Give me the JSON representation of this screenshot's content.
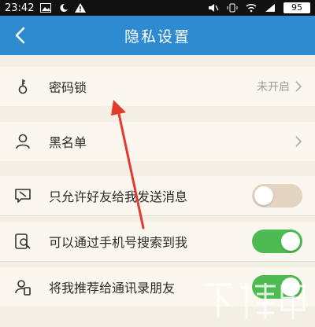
{
  "status_bar": {
    "time": "23:42",
    "battery": "95"
  },
  "nav": {
    "title": "隐私设置"
  },
  "rows": {
    "password_lock": {
      "label": "密码锁",
      "value": "未开启"
    },
    "blacklist": {
      "label": "黑名单"
    },
    "friends_only": {
      "label": "只允许好友给我发送消息",
      "state": "off"
    },
    "search_by_phone": {
      "label": "可以通过手机号搜索到我",
      "state": "on"
    },
    "recommend_contacts": {
      "label": "将我推荐给通讯录朋友",
      "state": "on"
    }
  },
  "colors": {
    "nav_blue": "#2e8bd0",
    "toggle_on": "#4dbb52",
    "toggle_off": "#e4d5c3",
    "annotation_red": "#e23b2e",
    "background": "#f4efe4"
  },
  "icons": {
    "back": "chevron-left-icon",
    "password_lock": "key-icon",
    "blacklist": "person-icon",
    "friends_only": "message-block-icon",
    "search_by_phone": "phone-search-icon",
    "recommend_contacts": "contact-recommend-icon"
  }
}
